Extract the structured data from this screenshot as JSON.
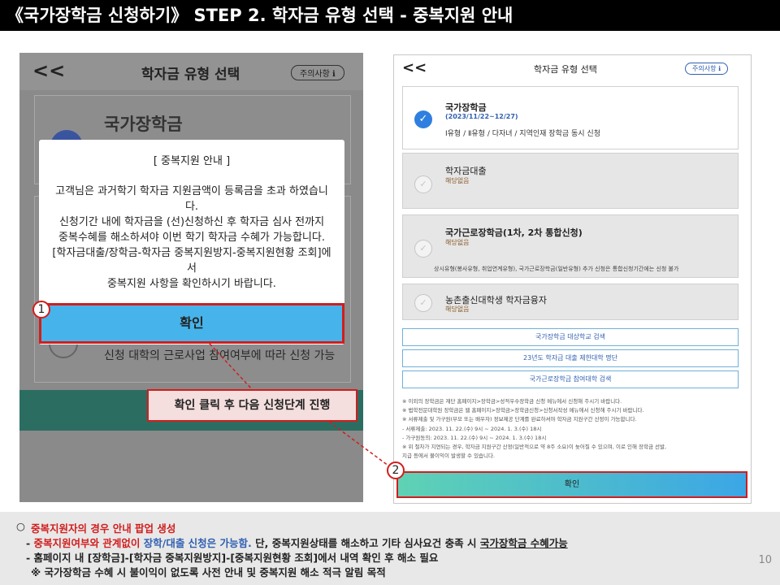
{
  "header": {
    "title": "《국가장학금 신청하기》 STEP 2. 학자금 유형 선택 - 중복지원 안내"
  },
  "left_phone": {
    "back": "<<",
    "title": "학자금 유형 선택",
    "notice_pill": "주의사항 ℹ",
    "bg_title": "국가장학금",
    "bg_text": "신청 대학의 근로사업 참여여부에 따라 신청 가능",
    "modal": {
      "title": "[ 중복지원 안내 ]",
      "body_lines": [
        "고객님은 과거학기 학자금 지원금액이 등록금을 초과 하였습니다.",
        "신청기간 내에 학자금을 (선)신청하신 후 학자금 심사 전까지",
        "중복수혜를 해소하셔야 이번 학기 학자금 수혜가 가능합니다.",
        "[학자금대출/장학금-학자금 중복지원방지-중복지원현황 조회]에서",
        "중복지원 사항을 확인하시기 바랍니다."
      ],
      "confirm": "확인"
    }
  },
  "badges": {
    "one": "1",
    "two": "2"
  },
  "callout": "확인 클릭 후 다음 신청단계 진행",
  "right_phone": {
    "back": "<<",
    "title": "학자금 유형 선택",
    "notice_pill": "주의사항 ℹ",
    "options": [
      {
        "title": "국가장학금",
        "sub": "(2023/11/22~12/27)",
        "desc": "Ⅰ유형 / Ⅱ유형 / 다자녀 / 지역인재 장학금 동시 신청"
      },
      {
        "title": "학자금대출",
        "sub": "해당없음"
      },
      {
        "title": "국가근로장학금(1차, 2차 통합신청)",
        "sub": "해당없음",
        "foot": "상시유형(봉사유형, 취업연계유형), 국가근로장학금(일반유형) 추가 신청은 통합신청기간에는 신청 불가"
      },
      {
        "title": "농촌출신대학생 학자금융자",
        "sub": "해당없음"
      }
    ],
    "links": [
      "국가장학금 대상학교 검색",
      "23년도 학자금 대출 제한대학 명단",
      "국가근로장학금 참여대학 검색"
    ],
    "notes": [
      "※ 이외의 장학금은 재단 홈페이지>장학금>성적우수장학금 신청 메뉴에서 신청해 주시기 바랍니다.",
      "※ 법학전문대학원 장학금은 웹 홈페이지>장학금>장학금신청>신청서작성 메뉴에서 신청해 주시기 바랍니다.",
      "※ 서류제출 및 가구원(부모 또는 배우자) 정보제공 단계를 완료하셔야 학자금 지원구간 산정이 가능합니다.",
      "  - 서류제출: 2023. 11. 22.(수) 9시 ~ 2024. 1. 3.(수) 18시",
      "  - 가구원동의: 2023. 11. 22.(수) 9시 ~ 2024. 1. 3.(수) 18시",
      "※ 위 절차가 지연되는 경우, 학자금 지원구간 산정(일반적으로 약 8주 소요)이 늦어질 수 있으며, 이로 인해 장학금 선발,",
      "   지급 등에서 불이익이 발생할 수 있습니다."
    ],
    "confirm": "확인"
  },
  "bottom": {
    "bullet": "○",
    "line1": "중복지원자의 경우 안내 팝업 생성",
    "line2_a": "- ",
    "line2_b": "중복지원여부와 관계없이 ",
    "line2_c": "장학/대출 신청은 가능함.",
    "line2_d": " 단, 중복지원상태를 해소하고 기타 심사요건 충족 시 ",
    "line2_e": "국가장학금 수혜가능",
    "line3": "- 홈페이지 내 [장학금]-[학자금 중복지원방지]-[중복지원현황 조회]에서 내역 확인 후 해소 필요",
    "line4": "※ 국가장학금 수혜 시 불이익이 없도록 사전 안내 및 중복지원 해소 적극 알림 목적",
    "page": "10"
  },
  "colors": {
    "accent_red": "#d21d1d",
    "brand_blue": "#2f5fb0",
    "confirm_blue": "#46b4ea"
  }
}
